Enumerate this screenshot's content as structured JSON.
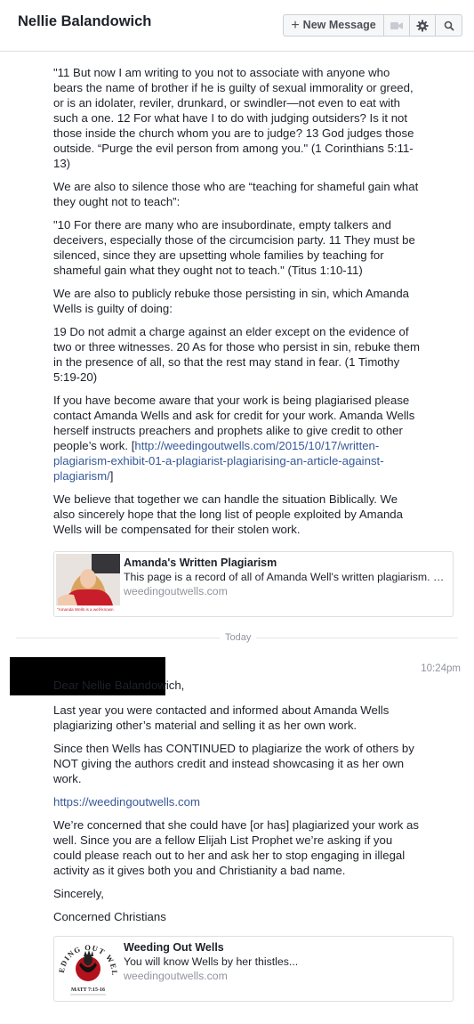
{
  "header": {
    "title": "Nellie Balandowich",
    "new_message_label": "New Message",
    "icons": [
      "video-camera-icon",
      "gear-icon",
      "search-icon"
    ]
  },
  "thread": {
    "earlier_paragraphs": [
      "\"11 But now I am writing to you not to associate with anyone who bears the name of brother if he is guilty of sexual immorality or greed, or is an idolater, reviler, drunkard, or swindler—not even to eat with such a one. 12 For what have I to do with judging outsiders? Is it not those inside the church whom you are to judge? 13 God judges those outside. “Purge the evil person from among you.\" (1 Corinthians 5:11-13)",
      "We are also to silence those who are “teaching for shameful gain what they ought not to teach”:",
      "\"10 For there are many who are insubordinate, empty talkers and deceivers, especially those of the circumcision party. 11 They must be silenced, since they are upsetting whole families by teaching for shameful gain what they ought not to teach.\" (Titus 1:10-11)",
      "We are also to publicly rebuke those persisting in sin, which Amanda Wells is guilty of doing:",
      "19 Do not admit a charge against an elder except on the evidence of two or three witnesses. 20 As for those who persist in sin, rebuke them in the presence of all, so that the rest may stand in fear. (1 Timothy 5:19-20)"
    ],
    "plagiarised_para_before": "If you have become aware that your work is being plagiarised please contact Amanda Wells and ask for credit for your work. Amanda Wells herself instructs preachers and prophets alike to give credit to other people’s work. [",
    "plagiarised_para_link": "http://weedingoutwells.com/2015/10/17/written-plagiarism-exhibit-01-a-plagiarist-plagiarising-an-article-against-plagiarism/",
    "plagiarised_para_after": "]",
    "closing_paragraph": "We believe that together we can handle the situation Biblically. We also sincerely hope that the long list of people exploited by Amanda Wells will be compensated for their stolen work.",
    "card1": {
      "title": "Amanda's Written Plagiarism",
      "description": "This page is a record of all of Amanda Well's written plagiarism. Wri...",
      "domain": "weedingoutwells.com",
      "thumb_caption": "\"Amanda Wells is a well-known"
    },
    "divider_label": "Today",
    "new_message": {
      "time": "10:24pm",
      "greeting": "Dear Nellie Balandowich,",
      "paragraphs": [
        "Last year you were contacted and informed about Amanda Wells plagiarizing other’s material and selling it as her own work.",
        "Since then Wells has CONTINUED to plagiarize the work of others by NOT giving the authors credit and instead showcasing it as her own work."
      ],
      "link": "https://weedingoutwells.com",
      "paragraph_after_link": "We’re concerned that she could have [or has] plagiarized your work as well. Since you are a fellow Elijah List Prophet we’re asking if you could please reach out to her and ask her to stop engaging in illegal activity as it gives both you and Christianity a bad name.",
      "signoff": "Sincerely,",
      "signature": "Concerned Christians",
      "card2": {
        "title": "Weeding Out Wells",
        "description": "You will know Wells by her thistles...",
        "domain": "weedingoutwells.com",
        "logo_text_top": "WEEDING OUT WELLS",
        "logo_text_bottom": "MATT 7:15-16"
      }
    }
  },
  "colors": {
    "link": "#365899",
    "meta_gray": "#90949c",
    "logo_red": "#b3121d"
  }
}
